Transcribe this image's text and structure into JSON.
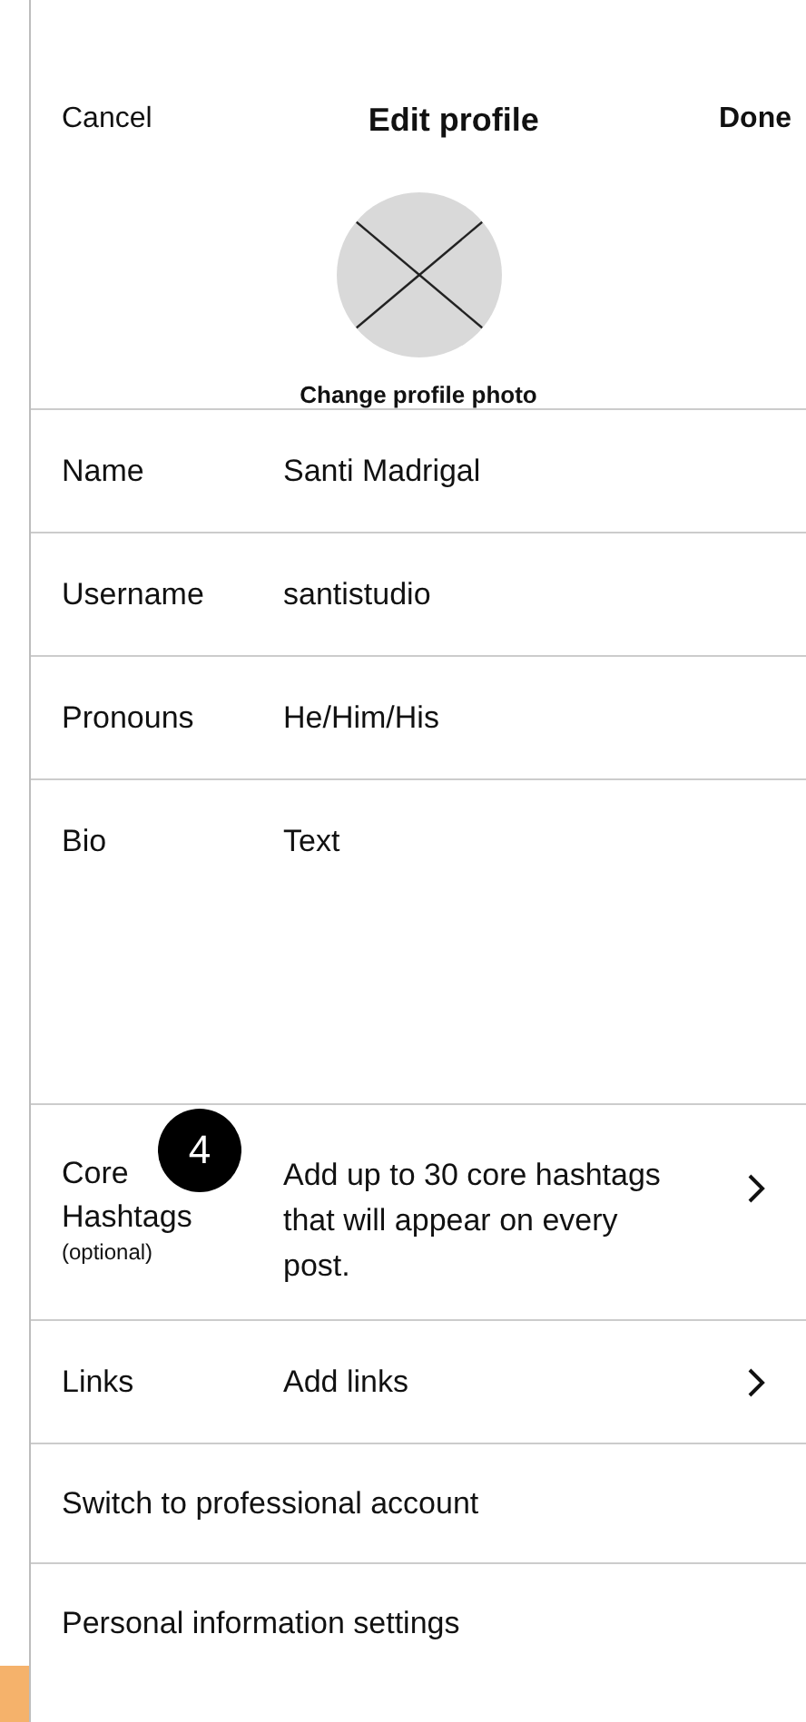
{
  "header": {
    "cancel": "Cancel",
    "title": "Edit profile",
    "done": "Done"
  },
  "photo": {
    "label": "Change profile photo"
  },
  "rows": [
    {
      "kind": "field",
      "label": "Name",
      "value": "Santi Madrigal"
    },
    {
      "kind": "field",
      "label": "Username",
      "value": "santistudio"
    },
    {
      "kind": "field",
      "label": "Pronouns",
      "value": "He/Him/His"
    },
    {
      "kind": "bio",
      "label": "Bio",
      "value": "Text"
    },
    {
      "kind": "hashtags",
      "label": "Core Hashtags",
      "note": "(optional)",
      "badge": "4",
      "value": "Add up to 30 core hashtags that will appear on every post."
    },
    {
      "kind": "link",
      "label": "Links",
      "value": "Add links"
    },
    {
      "kind": "action",
      "label": "Switch to professional account"
    },
    {
      "kind": "action",
      "label": "Personal information settings"
    }
  ]
}
